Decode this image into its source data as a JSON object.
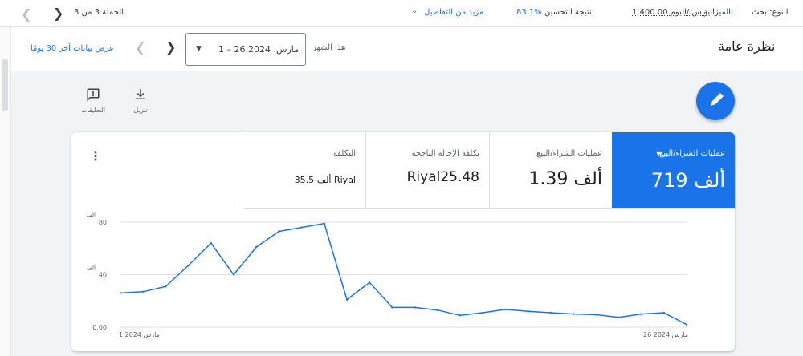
{
  "topbar": {
    "type_label": "النوع: بحث",
    "budget_label": "الميزانية:",
    "budget_value": "1,400.00 ر.س./اليوم",
    "score_label": "نتيجة التحسين:",
    "score_value": "83.1%",
    "more_details": "مزيد من التفاصيل",
    "campaign_pos": "الحملة 3 من 3"
  },
  "header": {
    "title": "نظرة عامة",
    "period_label": "هذا الشهر",
    "date_range": "1 – 26 مارس، 2024",
    "last30": "عرض بيانات آخر 30 يومًا"
  },
  "actions": {
    "download": "تنزيل",
    "comments": "التعليقات"
  },
  "metrics": [
    {
      "label": "عمليات الشراء/البيع",
      "value": "719 ألف",
      "active": true
    },
    {
      "label": "عمليات الشراء/البيع",
      "value": "1.39 ألف",
      "active": false
    },
    {
      "label": "تكلفة الإحالة الناجحة",
      "value": "Riyal25.48",
      "active": false
    },
    {
      "label": "التكلفة",
      "value": "35.5 ألف Riyal",
      "active": false
    }
  ],
  "colors": {
    "accent": "#1a73e8",
    "line": "#1a73e8"
  },
  "chart_data": {
    "type": "line",
    "y_tick_labels": [
      "0.00",
      "40",
      "80"
    ],
    "y_unit_label": "ألف",
    "ylim": [
      0,
      80
    ],
    "x_start_label": "1 مارس 2024",
    "x_end_label": "26 مارس 2024",
    "series": [
      {
        "values": [
          26,
          27,
          31,
          47,
          64,
          40,
          61,
          73,
          76,
          79,
          21,
          34,
          15,
          15,
          13,
          9,
          11,
          13.5,
          12,
          11,
          10,
          9.5,
          7.5,
          10,
          11,
          2
        ]
      }
    ],
    "grid": true
  }
}
